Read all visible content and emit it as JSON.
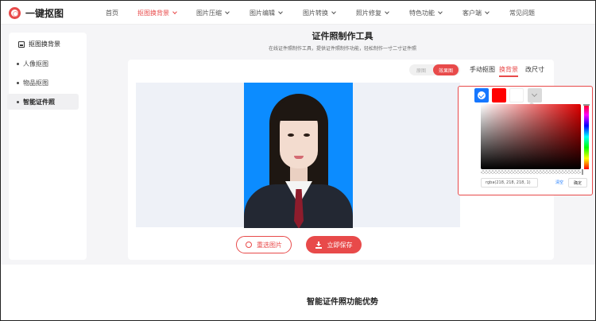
{
  "brand": {
    "name": "一键抠图"
  },
  "nav": {
    "items": [
      {
        "label": "首页",
        "dropdown": false,
        "active": false
      },
      {
        "label": "抠图换背景",
        "dropdown": true,
        "active": true
      },
      {
        "label": "图片压缩",
        "dropdown": true,
        "active": false
      },
      {
        "label": "图片编辑",
        "dropdown": true,
        "active": false
      },
      {
        "label": "图片转换",
        "dropdown": true,
        "active": false
      },
      {
        "label": "照片修复",
        "dropdown": true,
        "active": false
      },
      {
        "label": "特色功能",
        "dropdown": true,
        "active": false
      },
      {
        "label": "客户端",
        "dropdown": true,
        "active": false
      },
      {
        "label": "常见问题",
        "dropdown": false,
        "active": false
      }
    ]
  },
  "sidebar": {
    "title": "抠图换背景",
    "items": [
      {
        "label": "人像抠图",
        "active": false
      },
      {
        "label": "物品抠图",
        "active": false
      },
      {
        "label": "智能证件照",
        "active": true
      }
    ]
  },
  "main": {
    "title": "证件照制作工具",
    "subtitle": "在线证件照制作工具，提供证件照制作功能，轻松制作一寸二寸证件照"
  },
  "toolbar": {
    "toggle_off": "原图",
    "toggle_on": "效果图",
    "tabs": [
      {
        "label": "手动抠图",
        "active": false
      },
      {
        "label": "换背景",
        "active": true
      },
      {
        "label": "改尺寸",
        "active": false
      }
    ]
  },
  "color_picker": {
    "swatches": [
      "#1677ff",
      "#ff0000",
      "#ffffff",
      "#dadada"
    ],
    "selected_swatch": "#1677ff",
    "hue_color": "#e00000",
    "value": "rgba(218, 218, 218, 1)",
    "clear_label": "清空",
    "confirm_label": "确定"
  },
  "actions": {
    "reselect_label": "重选图片",
    "save_label": "立即保存"
  },
  "section": {
    "heading": "智能证件照功能优势"
  },
  "colors": {
    "accent": "#e84a4a",
    "photo_bg": "#0c8cff"
  }
}
